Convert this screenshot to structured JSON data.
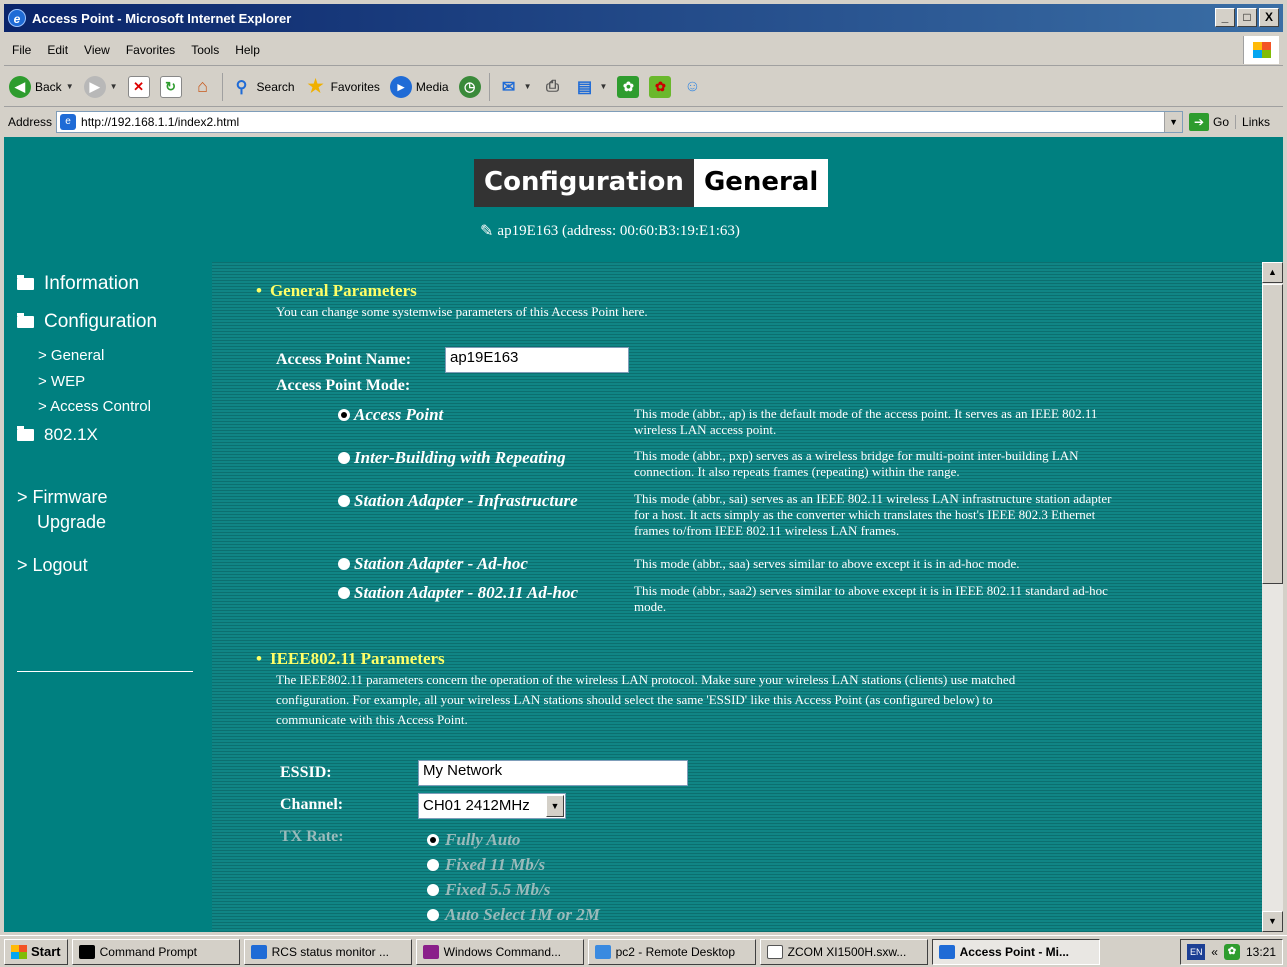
{
  "window": {
    "title": "Access Point - Microsoft Internet Explorer",
    "controls": [
      "_",
      "□",
      "X"
    ]
  },
  "menu": [
    "File",
    "Edit",
    "View",
    "Favorites",
    "Tools",
    "Help"
  ],
  "toolbar": {
    "back": "Back",
    "search": "Search",
    "favorites": "Favorites",
    "media": "Media"
  },
  "address": {
    "label": "Address",
    "url": "http://192.168.1.1/index2.html",
    "go": "Go",
    "links": "Links"
  },
  "header": {
    "title_a": "Configuration",
    "title_b": "General",
    "ap_info": "ap19E163 (address: 00:60:B3:19:E1:63)"
  },
  "sidebar": {
    "information": "Information",
    "configuration": "Configuration",
    "sub": [
      "> General",
      "> WEP",
      "> Access Control"
    ],
    "dot1x": "802.1X",
    "firmware_1": "> Firmware",
    "firmware_2": "Upgrade",
    "logout": "> Logout"
  },
  "general": {
    "title": "General Parameters",
    "desc": "You can change some systemwise parameters of this Access Point here.",
    "name_label": "Access Point Name:",
    "name_value": "ap19E163",
    "mode_label": "Access Point Mode:",
    "modes": [
      {
        "label": "Access Point",
        "selected": true,
        "d1": "This mode (abbr., ap) is the default mode of the access point. It serves as an IEEE 802.11",
        "d2": "wireless LAN access point.",
        "d3": ""
      },
      {
        "label": "Inter-Building with Repeating",
        "selected": false,
        "d1": "This mode (abbr., pxp) serves as a wireless bridge for multi-point inter-building LAN",
        "d2": "connection. It also repeats frames (repeating) within the range.",
        "d3": ""
      },
      {
        "label": "Station Adapter - Infrastructure",
        "selected": false,
        "d1": "This mode (abbr., sai) serves as an IEEE 802.11 wireless LAN infrastructure station adapter",
        "d2": "for a host. It acts simply as the converter which translates the host's IEEE 802.3 Ethernet",
        "d3": "frames to/from IEEE 802.11 wireless LAN frames."
      },
      {
        "label": "Station Adapter - Ad-hoc",
        "selected": false,
        "d1": "This mode (abbr., saa) serves similar to above except it is in ad-hoc mode.",
        "d2": "",
        "d3": ""
      },
      {
        "label": "Station Adapter - 802.11 Ad-hoc",
        "selected": false,
        "d1": "This mode (abbr., saa2) serves similar to above except it is in IEEE 802.11 standard ad-hoc",
        "d2": "mode.",
        "d3": ""
      }
    ]
  },
  "ieee": {
    "title": "IEEE802.11 Parameters",
    "desc1": "The IEEE802.11 parameters concern the operation of the wireless LAN protocol. Make sure your wireless LAN stations (clients) use matched",
    "desc2": "configuration. For example, all your wireless LAN stations should select the same 'ESSID' like this Access Point (as configured below) to",
    "desc3": "communicate with this Access Point.",
    "essid_label": "ESSID:",
    "essid_value": "My Network",
    "channel_label": "Channel:",
    "channel_value": "CH01 2412MHz",
    "txrate_label": "TX Rate:",
    "txrates": [
      "Fully Auto",
      "Fixed 11 Mb/s",
      "Fixed 5.5 Mb/s",
      "Auto Select 1M or 2M"
    ]
  },
  "taskbar": {
    "start": "Start",
    "tasks": [
      "Command Prompt",
      "RCS status monitor ...",
      "Windows Command...",
      "pc2 - Remote Desktop",
      "ZCOM XI1500H.sxw...",
      "Access Point - Mi..."
    ],
    "lang": "EN",
    "time": "13:21",
    "chevron": "«"
  }
}
